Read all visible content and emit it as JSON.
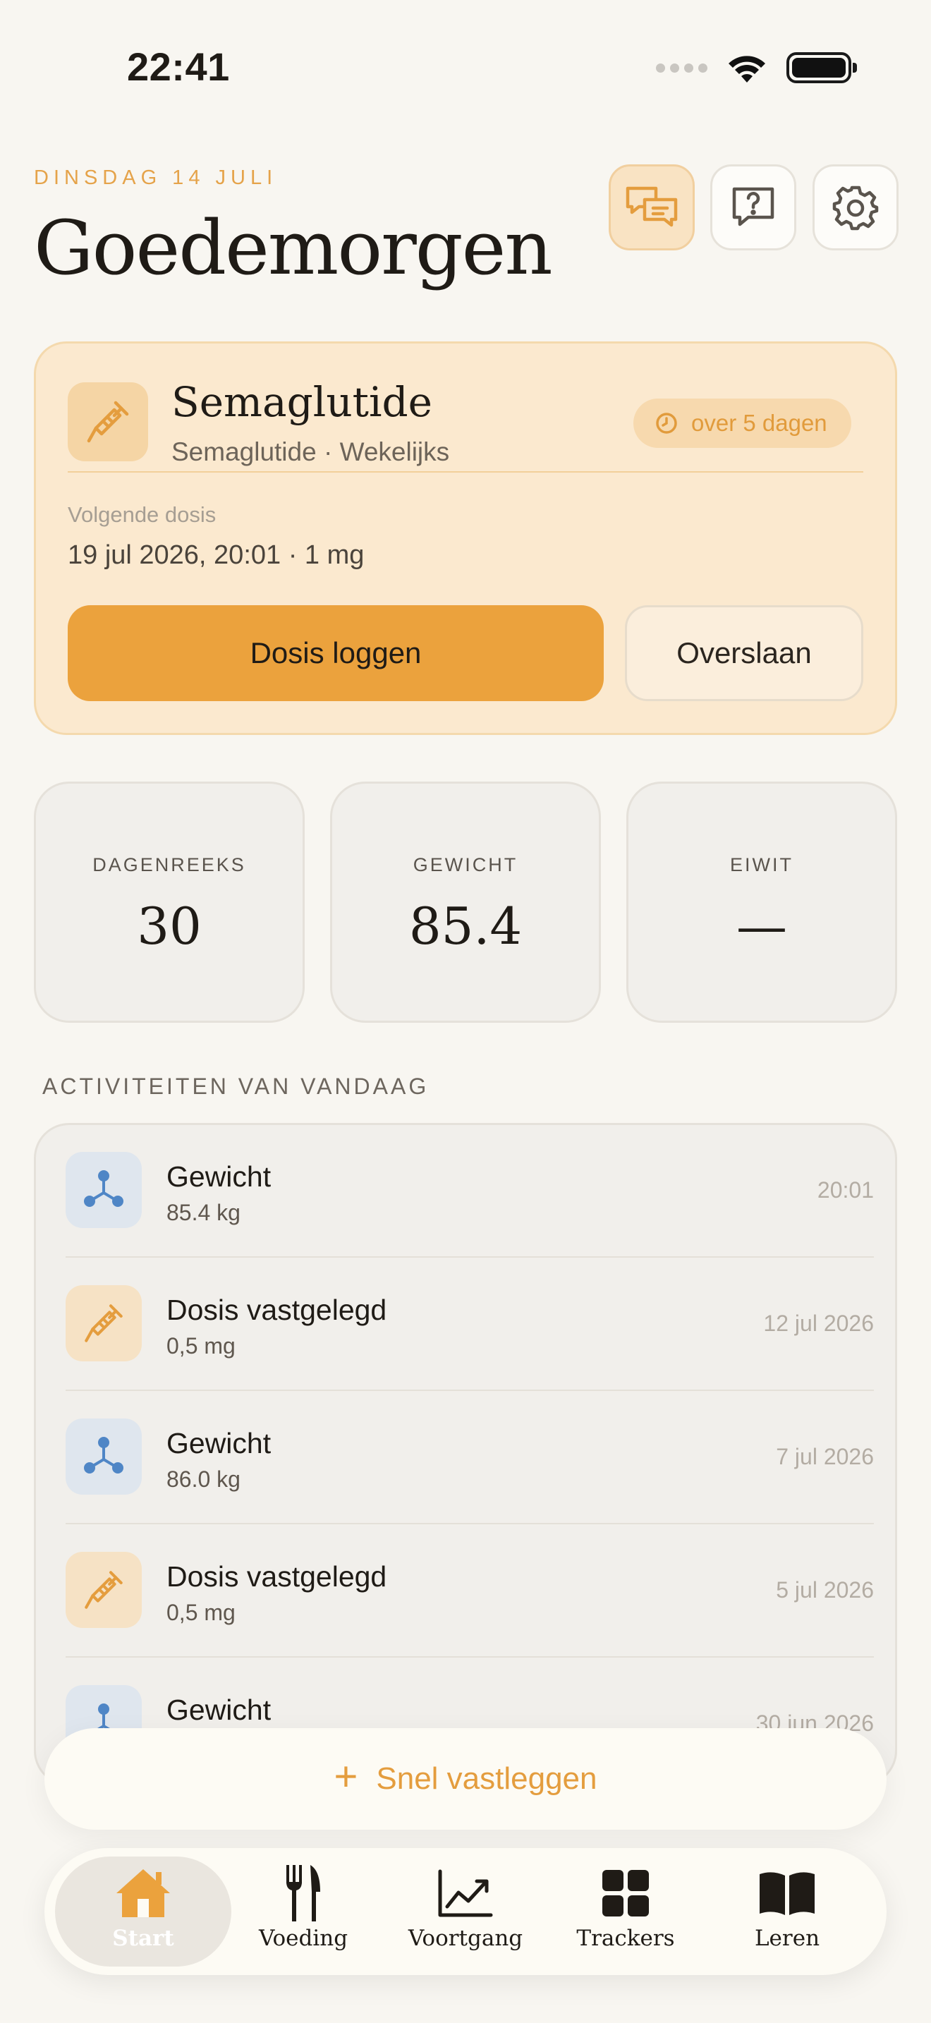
{
  "status_bar": {
    "time": "22:41"
  },
  "header": {
    "date": "DINSDAG 14 JULI",
    "greeting": "Goedemorgen"
  },
  "medication": {
    "name": "Semaglutide",
    "subtitle": "Semaglutide · Wekelijks",
    "badge": "over 5 dagen",
    "next_label": "Volgende dosis",
    "next_value": "19 jul 2026, 20:01 · 1 mg",
    "primary_button": "Dosis loggen",
    "secondary_button": "Overslaan"
  },
  "stats": [
    {
      "label": "DAGENREEKS",
      "value": "30"
    },
    {
      "label": "GEWICHT",
      "value": "85.4"
    },
    {
      "label": "EIWIT",
      "value": "—"
    }
  ],
  "activities": {
    "title": "ACTIVITEITEN VAN VANDAAG",
    "items": [
      {
        "type": "weight",
        "title": "Gewicht",
        "sub": "85.4 kg",
        "time": "20:01"
      },
      {
        "type": "dose",
        "title": "Dosis vastgelegd",
        "sub": "0,5 mg",
        "time": "12 jul 2026"
      },
      {
        "type": "weight",
        "title": "Gewicht",
        "sub": "86.0 kg",
        "time": "7 jul 2026"
      },
      {
        "type": "dose",
        "title": "Dosis vastgelegd",
        "sub": "0,5 mg",
        "time": "5 jul 2026"
      },
      {
        "type": "weight",
        "title": "Gewicht",
        "sub": "",
        "time": "30 jun 2026"
      }
    ]
  },
  "quick_log": {
    "label": "Snel vastleggen"
  },
  "nav": {
    "items": [
      {
        "label": "Start",
        "icon": "home-icon",
        "active": true
      },
      {
        "label": "Voeding",
        "icon": "fork-knife-icon"
      },
      {
        "label": "Voortgang",
        "icon": "trend-chart-icon"
      },
      {
        "label": "Trackers",
        "icon": "grid-icon"
      },
      {
        "label": "Leren",
        "icon": "book-icon"
      }
    ]
  },
  "colors": {
    "accent": "#eba23d",
    "accent_text": "#e49d3e",
    "card_bg": "#fbe9cf",
    "background": "#f8f6f1",
    "weight_icon": "#4f86c6"
  }
}
